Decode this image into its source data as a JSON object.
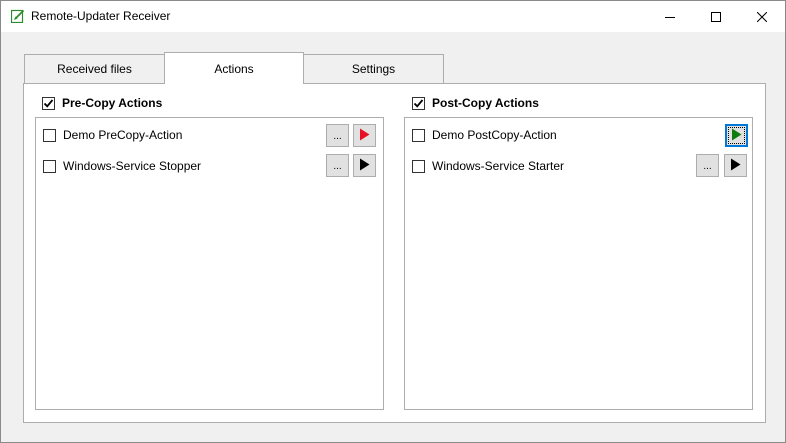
{
  "window": {
    "title": "Remote-Updater Receiver"
  },
  "tabs": [
    {
      "label": "Received files",
      "active": false
    },
    {
      "label": "Actions",
      "active": true
    },
    {
      "label": "Settings",
      "active": false
    }
  ],
  "pre_copy": {
    "header": "Pre-Copy Actions",
    "checked": true,
    "items": [
      {
        "label": "Demo PreCopy-Action",
        "checked": false,
        "has_options": true,
        "options_label": "...",
        "run_color": "#e81123"
      },
      {
        "label": "Windows-Service Stopper",
        "checked": false,
        "has_options": true,
        "options_label": "...",
        "run_color": "#000000"
      }
    ]
  },
  "post_copy": {
    "header": "Post-Copy Actions",
    "checked": true,
    "items": [
      {
        "label": "Demo PostCopy-Action",
        "checked": false,
        "has_options": false,
        "run_color": "#107c10",
        "focused": true
      },
      {
        "label": "Windows-Service Starter",
        "checked": false,
        "has_options": true,
        "options_label": "...",
        "run_color": "#000000"
      }
    ]
  },
  "icons": {
    "app": "app-edit-icon",
    "minimize": "minimize-icon",
    "maximize": "maximize-icon",
    "close": "close-icon",
    "run": "play-icon",
    "checkmark": "checkmark-icon"
  }
}
